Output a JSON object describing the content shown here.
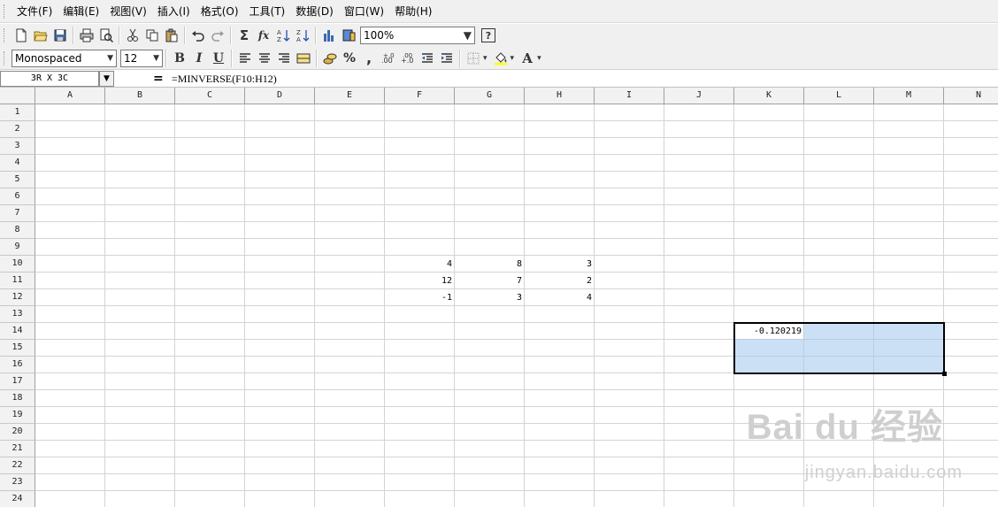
{
  "menu": [
    "文件(F)",
    "编辑(E)",
    "视图(V)",
    "插入(I)",
    "格式(O)",
    "工具(T)",
    "数据(D)",
    "窗口(W)",
    "帮助(H)"
  ],
  "toolbar": {
    "zoom": "100%",
    "font_name": "Monospaced",
    "font_size": "12",
    "bold": "B",
    "italic": "I",
    "underline": "U",
    "percent": "%",
    "comma": ",",
    "sum": "Σ",
    "fx": "fx",
    "font_color": "A",
    "help": "?"
  },
  "formula_bar": {
    "name_box": "3R X 3C",
    "equals": "=",
    "formula": "=MINVERSE(F10:H12)"
  },
  "columns": [
    "A",
    "B",
    "C",
    "D",
    "E",
    "F",
    "G",
    "H",
    "I",
    "J",
    "K",
    "L",
    "M",
    "N"
  ],
  "rows": [
    "1",
    "2",
    "3",
    "4",
    "5",
    "6",
    "7",
    "8",
    "9",
    "10",
    "11",
    "12",
    "13",
    "14",
    "15",
    "16",
    "17",
    "18",
    "19",
    "20",
    "21",
    "22",
    "23",
    "24"
  ],
  "cells": [
    {
      "ref": "F10",
      "value": "4"
    },
    {
      "ref": "G10",
      "value": "8"
    },
    {
      "ref": "H10",
      "value": "3"
    },
    {
      "ref": "F11",
      "value": "12"
    },
    {
      "ref": "G11",
      "value": "7"
    },
    {
      "ref": "H11",
      "value": "2"
    },
    {
      "ref": "F12",
      "value": "-1"
    },
    {
      "ref": "G12",
      "value": "3"
    },
    {
      "ref": "H12",
      "value": "4"
    },
    {
      "ref": "K14",
      "value": "-0.120219"
    }
  ],
  "selection": "K14:M16",
  "watermark": {
    "main": "Bai du 经验",
    "sub": "jingyan.baidu.com"
  },
  "colors": {
    "selection_fill": "#cce0f5",
    "header_bg": "#f2f2f2",
    "gridline": "#d4d4d4"
  }
}
